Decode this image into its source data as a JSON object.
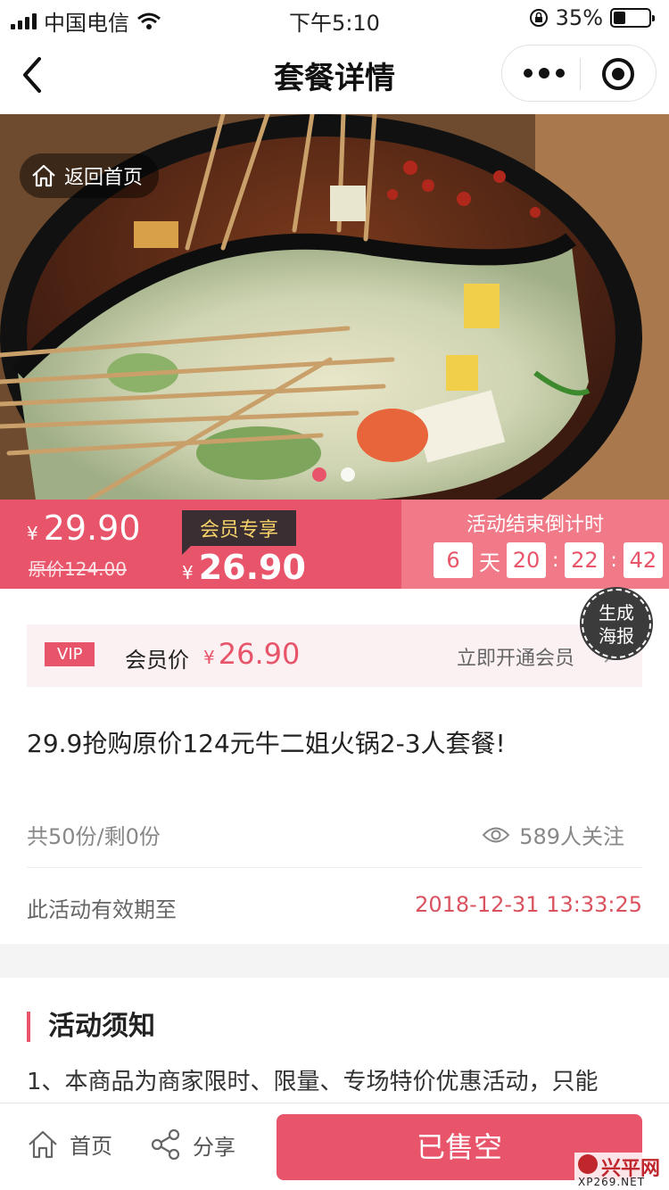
{
  "status_bar": {
    "carrier": "中国电信",
    "time": "下午5:10",
    "battery": "35%"
  },
  "nav": {
    "title": "套餐详情"
  },
  "hero": {
    "home_label": "返回首页",
    "active_dot": 0,
    "dot_count": 2
  },
  "price": {
    "currency": "¥",
    "current": "29.90",
    "original": "原价124.00",
    "member_tag": "会员专享",
    "member_price": "26.90"
  },
  "countdown": {
    "title": "活动结束倒计时",
    "days": "6",
    "day_unit": "天",
    "hours": "20",
    "minutes": "22",
    "seconds": "42",
    "sep": ":"
  },
  "poster": {
    "line1": "生成",
    "line2": "海报"
  },
  "vip": {
    "badge": "VIP",
    "label": "会员价",
    "currency": "¥",
    "price": "26.90",
    "open_label": "立即开通会员"
  },
  "product": {
    "title": "29.9抢购原价124元牛二姐火锅2-3人套餐!"
  },
  "stats": {
    "stock": "共50份/剩0份",
    "views": "589人关注"
  },
  "validity": {
    "label": "此活动有效期至",
    "date": "2018-12-31 13:33:25"
  },
  "notice": {
    "title": "活动须知",
    "text": "1、本商品为商家限时、限量、专场特价优惠活动，只能"
  },
  "tab_bar": {
    "home": "首页",
    "share": "分享",
    "action": "已售空"
  },
  "watermark": {
    "cn": "兴平网",
    "en": "XP269.NET"
  },
  "colors": {
    "accent": "#e8556a",
    "countdown_bg": "#f07a88",
    "gold": "#f6d26a"
  }
}
